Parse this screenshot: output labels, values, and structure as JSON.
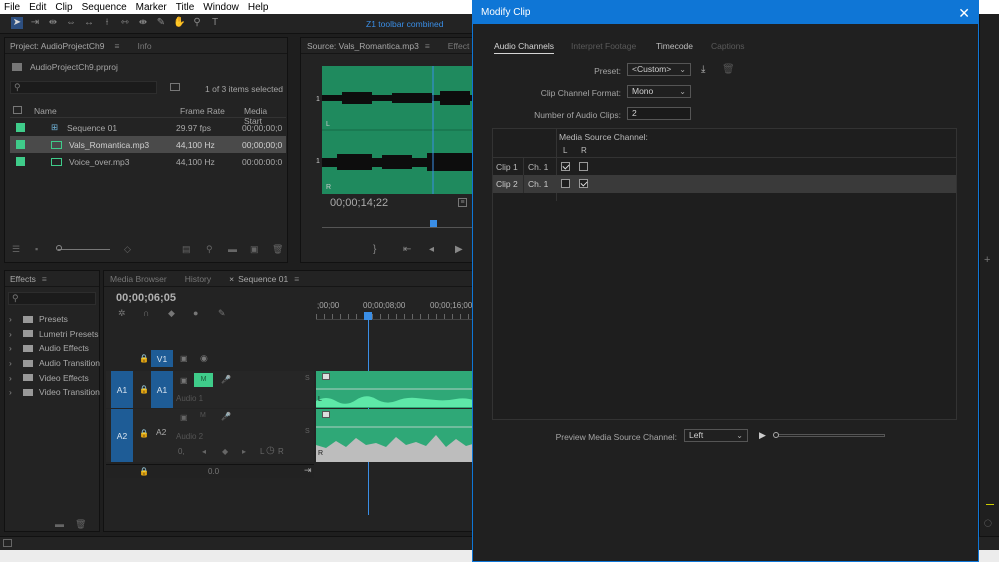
{
  "menu": [
    "File",
    "Edit",
    "Clip",
    "Sequence",
    "Marker",
    "Title",
    "Window",
    "Help"
  ],
  "workspace_label": "Z1 toolbar combined",
  "project": {
    "tabs": [
      "Project: AudioProjectCh9",
      "Info"
    ],
    "filename": "AudioProjectCh9.prproj",
    "selection_status": "1 of 3 items selected",
    "columns": {
      "name": "Name",
      "rate": "Frame Rate",
      "start": "Media Start"
    },
    "items": [
      {
        "name": "Sequence 01",
        "rate": "29.97 fps",
        "start": "00;00;00;0"
      },
      {
        "name": "Vals_Romantica.mp3",
        "rate": "44,100 Hz",
        "start": "00;00;00;0"
      },
      {
        "name": "Voice_over.mp3",
        "rate": "44,100 Hz",
        "start": "00:00:00:0"
      }
    ]
  },
  "source": {
    "tabs": [
      "Source: Vals_Romantica.mp3",
      "Effect C"
    ],
    "timecode": "00;00;14;22",
    "channel_labels": [
      "1",
      "L",
      "1",
      "R"
    ]
  },
  "effects": {
    "tab": "Effects",
    "items": [
      "Presets",
      "Lumetri Presets",
      "Audio Effects",
      "Audio Transition",
      "Video Effects",
      "Video Transition"
    ]
  },
  "timeline": {
    "tabs": [
      "Media Browser",
      "History",
      "Sequence 01"
    ],
    "timecode": "00;00;06;05",
    "ruler": [
      ";00;00",
      "00;00;08;00",
      "00;00;16;00"
    ],
    "tracks": [
      {
        "src": "",
        "name": "V1",
        "label": ""
      },
      {
        "src": "A1",
        "name": "A1",
        "label": "Audio 1"
      },
      {
        "src": "A2",
        "name": "A2",
        "label": "Audio 2"
      }
    ],
    "master_value": "0.0",
    "track_btn_m": "M",
    "track_btn_s": "S",
    "pan_label_l": "L",
    "pan_label_r": "R"
  },
  "dialog": {
    "title": "Modify Clip",
    "tabs": [
      "Audio Channels",
      "Interpret Footage",
      "Timecode",
      "Captions"
    ],
    "preset_label": "Preset:",
    "preset_value": "<Custom>",
    "format_label": "Clip Channel Format:",
    "format_value": "Mono",
    "num_clips_label": "Number of Audio Clips:",
    "num_clips_value": "2",
    "media_source_header": "Media Source Channel:",
    "channel_cols": [
      "L",
      "R"
    ],
    "rows": [
      {
        "clip": "Clip 1",
        "ch": "Ch. 1",
        "L": true,
        "R": false
      },
      {
        "clip": "Clip 2",
        "ch": "Ch. 1",
        "L": false,
        "R": true
      }
    ],
    "preview_label": "Preview Media Source Channel:",
    "preview_value": "Left"
  },
  "colors": {
    "accent": "#0f76d6",
    "audio_clip": "#2fa877",
    "track_blue": "#1e5c96",
    "playhead": "#3a8ee6"
  }
}
